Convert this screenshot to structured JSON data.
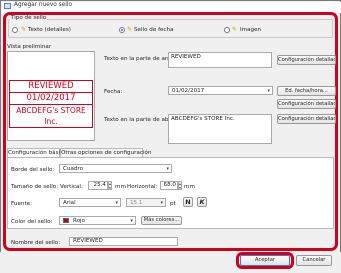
{
  "window": {
    "title": "Agregar nuevo sello"
  },
  "stamp_type": {
    "legend": "Tipo de sello",
    "options": [
      {
        "label": "Texto (detalles)",
        "selected": false,
        "icon": "text-stamp-icon"
      },
      {
        "label": "Sello de fecha",
        "selected": true,
        "icon": "date-stamp-icon"
      },
      {
        "label": "Imagen",
        "selected": false,
        "icon": "image-stamp-icon"
      }
    ]
  },
  "preview": {
    "label": "Vista preliminar",
    "lines": [
      "REVIEWED",
      "01/02/2017",
      "ABCDEFG's STORE Inc."
    ],
    "color": "#d0021b"
  },
  "top_text": {
    "label": "Texto en la parte de arriba:",
    "value": "REVIEWED",
    "button": "Configuración detallada"
  },
  "date": {
    "label": "Fecha:",
    "value": "01/02/2017",
    "format_button": "Ed. fecha/hora...",
    "button": "Configuración detallada"
  },
  "bottom_text": {
    "label": "Texto en la parte de abajo:",
    "value": "ABCDEFG's STORE Inc.",
    "button": "Configuración detallada"
  },
  "tabs": [
    {
      "label": "Configuración básica",
      "active": true
    },
    {
      "label": "Otras opciones de configuración",
      "active": false
    }
  ],
  "basic": {
    "border_label": "Borde del sello:",
    "border_value": "Cuadro",
    "size_label": "Tamaño de sello:",
    "vertical_label": "Vertical:",
    "vertical_value": "25.4",
    "horizontal_label": "Horizontal:",
    "horizontal_value": "68.0",
    "unit": "mm",
    "font_label": "Fuente:",
    "font_value": "Arial",
    "font_size": "15.1",
    "font_size_unit": "pt",
    "bold": "N",
    "italic": "K",
    "color_label": "Color del sello:",
    "color_value": "Rojo",
    "color_hex": "#c0000c",
    "more_colors": "Más colores..."
  },
  "name": {
    "label": "Nombre del sello:",
    "value": "REVIEWED"
  },
  "footer": {
    "ok": "Aceptar",
    "cancel": "Cancelar"
  },
  "colors": {
    "highlight": "#d0021b",
    "accent": "#2a6ed8"
  }
}
